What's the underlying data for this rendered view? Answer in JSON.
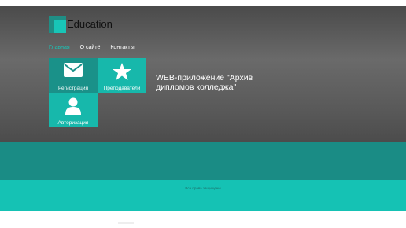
{
  "brand": {
    "name": "Education",
    "logo_icon": "logo-squares-icon"
  },
  "nav": {
    "items": [
      {
        "label": "Главная",
        "active": true
      },
      {
        "label": "О сайтё",
        "active": false
      },
      {
        "label": "Контакты",
        "active": false
      }
    ]
  },
  "tiles": [
    {
      "label": "Регистрация",
      "icon": "envelope-icon"
    },
    {
      "label": "Преподаватели",
      "icon": "star-icon"
    },
    {
      "label": "Авторизация",
      "icon": "user-icon"
    }
  ],
  "hero": {
    "title": "WEB-приложение \"Архив дипломов колледжа\""
  },
  "footer": {
    "copyright": "Все права защищены"
  },
  "colors": {
    "accent": "#19c4b6",
    "teal_dark": "#1a8c85",
    "teal_light": "#15c2b4"
  }
}
